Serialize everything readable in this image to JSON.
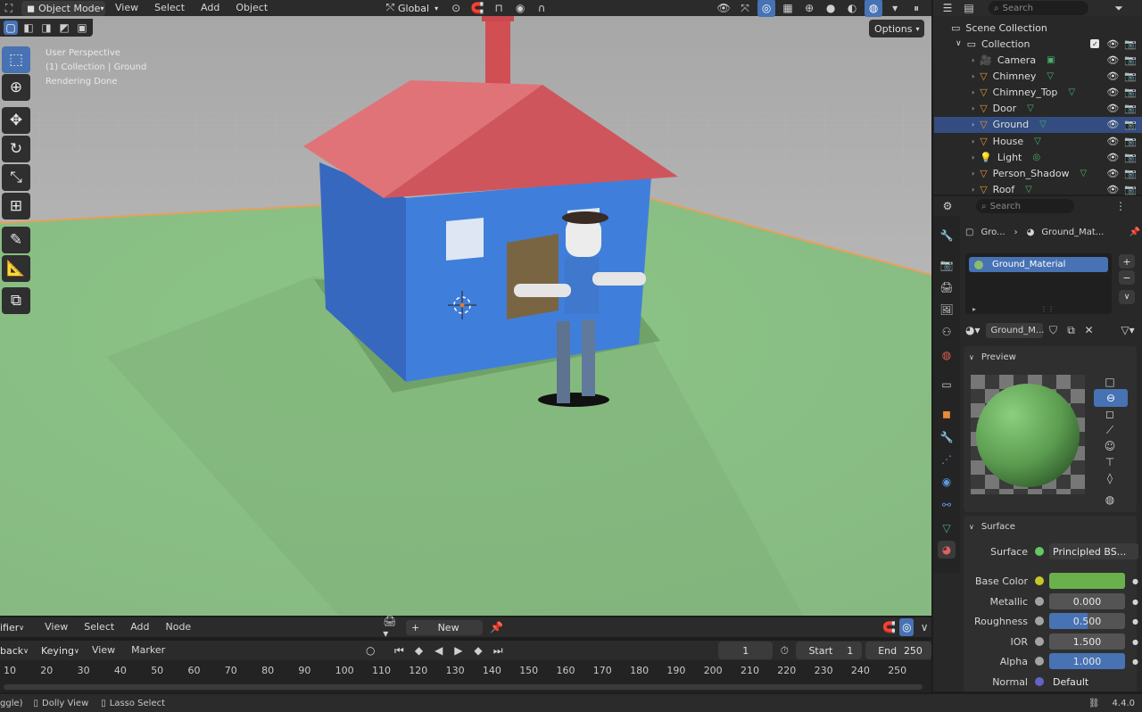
{
  "viewport_header": {
    "mode": "Object Mode",
    "menus": [
      "View",
      "Select",
      "Add",
      "Object"
    ],
    "transform": "Global",
    "options": "Options"
  },
  "overlay_text": {
    "line1": "User Perspective",
    "line2": "(1) Collection | Ground",
    "line3": "Rendering Done"
  },
  "outliner": {
    "search_placeholder": "Search",
    "scene_collection": "Scene Collection",
    "collection": "Collection",
    "items": [
      {
        "name": "Camera"
      },
      {
        "name": "Chimney"
      },
      {
        "name": "Chimney_Top"
      },
      {
        "name": "Door"
      },
      {
        "name": "Ground",
        "selected": true
      },
      {
        "name": "House"
      },
      {
        "name": "Light"
      },
      {
        "name": "Person_Shadow"
      },
      {
        "name": "Roof"
      }
    ]
  },
  "properties": {
    "search_placeholder": "Search",
    "breadcrumb_object": "Gro...",
    "breadcrumb_material": "Ground_Mat...",
    "material_slot": "Ground_Material",
    "material_name": "Ground_M...",
    "preview_label": "Preview",
    "surface_panel": "Surface",
    "rows": {
      "surface_label": "Surface",
      "surface_value": "Principled BS...",
      "base_color_label": "Base Color",
      "base_color": "#6ab04c",
      "metallic_label": "Metallic",
      "metallic_value": "0.000",
      "roughness_label": "Roughness",
      "roughness_value": "0.500",
      "roughness_fraction": 0.5,
      "ior_label": "IOR",
      "ior_value": "1.500",
      "alpha_label": "Alpha",
      "alpha_value": "1.000",
      "alpha_fraction": 1.0,
      "normal_label": "Normal",
      "normal_value": "Default"
    }
  },
  "node_header": {
    "editor_fragment": "ifier",
    "menus": [
      "View",
      "Select",
      "Add",
      "Node"
    ],
    "new_button": "New"
  },
  "timeline": {
    "playback": "back",
    "keying": "Keying",
    "menus": [
      "View",
      "Marker"
    ],
    "current_frame": "1",
    "start_label": "Start",
    "start_value": "1",
    "end_label": "End",
    "end_value": "250",
    "ticks": [
      "10",
      "20",
      "30",
      "40",
      "50",
      "60",
      "70",
      "80",
      "90",
      "100",
      "110",
      "120",
      "130",
      "140",
      "150",
      "160",
      "170",
      "180",
      "190",
      "200",
      "210",
      "220",
      "230",
      "240",
      "250"
    ]
  },
  "status_bar": {
    "item1": "ggle)",
    "item2": "Dolly View",
    "item3": "Lasso Select",
    "version": "4.4.0"
  },
  "colors": {
    "accent": "#4772b3",
    "selection": "#334d80",
    "ground": "#8fbf88",
    "house": "#3b78d0",
    "roof": "#d65c62"
  }
}
